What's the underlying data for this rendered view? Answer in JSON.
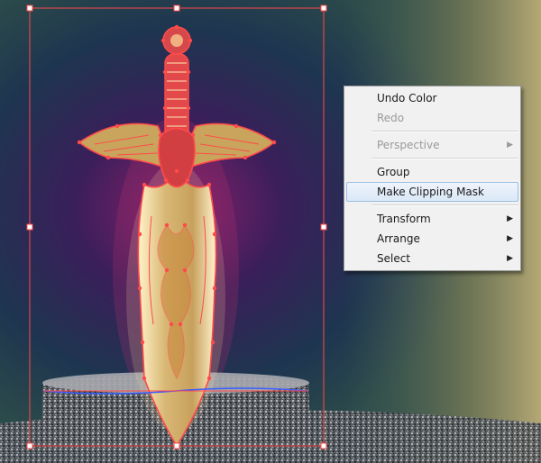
{
  "menu": {
    "items": [
      {
        "label": "Undo Color",
        "enabled": true,
        "submenu": false
      },
      {
        "label": "Redo",
        "enabled": false,
        "submenu": false
      },
      {
        "label": "Perspective",
        "enabled": false,
        "submenu": true
      },
      {
        "label": "Group",
        "enabled": true,
        "submenu": false
      },
      {
        "label": "Make Clipping Mask",
        "enabled": true,
        "submenu": false,
        "highlighted": true
      },
      {
        "label": "Transform",
        "enabled": true,
        "submenu": true
      },
      {
        "label": "Arrange",
        "enabled": true,
        "submenu": true
      },
      {
        "label": "Select",
        "enabled": true,
        "submenu": true
      }
    ],
    "submenu_arrow_icon": "triangle-right-icon"
  },
  "colors": {
    "selection": "#ff4a4a",
    "menu_bg": "#f1f1f1",
    "highlight_border": "#9ebfe3"
  }
}
